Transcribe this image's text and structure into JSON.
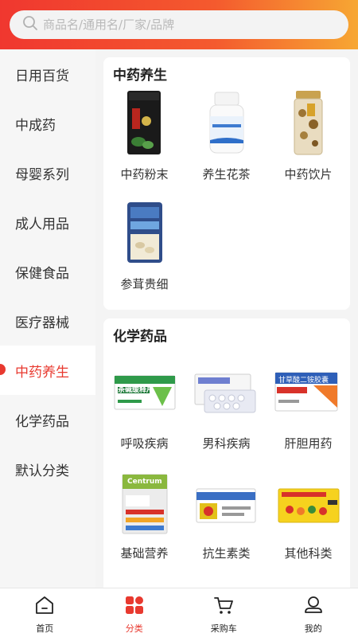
{
  "search": {
    "placeholder": "商品名/通用名/厂家/品牌"
  },
  "sidebar": {
    "items": [
      {
        "label": "日用百货"
      },
      {
        "label": "中成药"
      },
      {
        "label": "母婴系列"
      },
      {
        "label": "成人用品"
      },
      {
        "label": "保健食品"
      },
      {
        "label": "医疗器械"
      },
      {
        "label": "中药养生",
        "active": true
      },
      {
        "label": "化学药品"
      },
      {
        "label": "默认分类"
      }
    ]
  },
  "sections": [
    {
      "title": "中药养生",
      "products": [
        {
          "name": "中药粉末",
          "icon": "tea-can-icon"
        },
        {
          "name": "养生花茶",
          "icon": "pill-bottle-icon"
        },
        {
          "name": "中药饮片",
          "icon": "herb-jar-icon"
        },
        {
          "name": "参茸贵细",
          "icon": "ginseng-pack-icon"
        }
      ]
    },
    {
      "title": "化学药品",
      "products": [
        {
          "name": "呼吸疾病",
          "icon": "medicine-box-green-icon",
          "box_text": "茶碱缓释片"
        },
        {
          "name": "男科疾病",
          "icon": "blister-pack-icon"
        },
        {
          "name": "肝胆用药",
          "icon": "medicine-box-red-icon",
          "box_text": "甘草酸二铵胶囊"
        },
        {
          "name": "基础营养",
          "icon": "vitamin-box-icon",
          "box_text": "Centrum"
        },
        {
          "name": "抗生素类",
          "icon": "antibiotic-box-icon"
        },
        {
          "name": "其他科类",
          "icon": "medicine-box-yellow-icon"
        }
      ]
    }
  ],
  "tabbar": {
    "tabs": [
      {
        "label": "首页",
        "icon": "home-icon"
      },
      {
        "label": "分类",
        "icon": "category-icon",
        "active": true
      },
      {
        "label": "采购车",
        "icon": "cart-icon"
      },
      {
        "label": "我的",
        "icon": "user-icon"
      }
    ]
  },
  "colors": {
    "accent": "#e8392f",
    "header_start": "#f0372f",
    "header_end": "#f7a733"
  }
}
